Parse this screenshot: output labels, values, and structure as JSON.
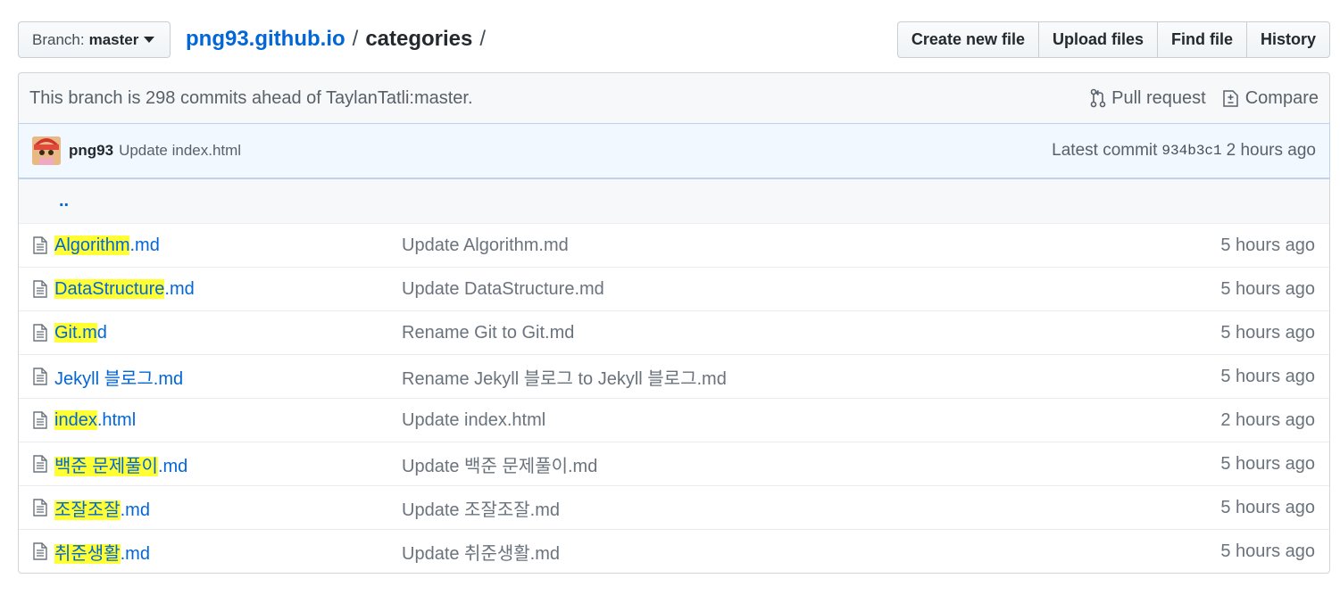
{
  "topbar": {
    "branch_label": "Branch:",
    "branch_value": "master",
    "repo": "png93.github.io",
    "separator": "/",
    "directory": "categories",
    "trailing_separator": "/",
    "buttons": {
      "create": "Create new file",
      "upload": "Upload files",
      "find": "Find file",
      "history": "History"
    }
  },
  "branch_info": {
    "text": "This branch is 298 commits ahead of TaylanTatli:master.",
    "pull_request": "Pull request",
    "compare": "Compare"
  },
  "commit": {
    "author": "png93",
    "message": "Update index.html",
    "latest_label": "Latest commit",
    "sha": "934b3c1",
    "age": "2 hours ago"
  },
  "up_link": "..",
  "files": [
    {
      "hl": "Algorithm",
      "rest": ".md",
      "message": "Update Algorithm.md",
      "age": "5 hours ago"
    },
    {
      "hl": "DataStructure",
      "rest": ".md",
      "message": "Update DataStructure.md",
      "age": "5 hours ago"
    },
    {
      "hl": "Git.m",
      "rest": "d",
      "message": "Rename Git to Git.md",
      "age": "5 hours ago"
    },
    {
      "hl": "",
      "rest": "Jekyll 블로그.md",
      "message": "Rename Jekyll 블로그 to Jekyll 블로그.md",
      "age": "5 hours ago"
    },
    {
      "hl": "index",
      "rest": ".html",
      "message": "Update index.html",
      "age": "2 hours ago"
    },
    {
      "hl": "백준 문제풀이",
      "rest": ".md",
      "message": "Update 백준 문제풀이.md",
      "age": "5 hours ago"
    },
    {
      "hl": "조잘조잘",
      "rest": ".md",
      "message": "Update 조잘조잘.md",
      "age": "5 hours ago"
    },
    {
      "hl": "취준생활",
      "rest": ".md",
      "message": "Update 취준생활.md",
      "age": "5 hours ago"
    }
  ],
  "colors": {
    "link": "#0366d6",
    "highlight": "#ffff33",
    "muted": "#6a737d"
  },
  "icons": {
    "file": "file-text-icon",
    "pull_request": "git-pull-request-icon",
    "compare": "diff-icon"
  }
}
